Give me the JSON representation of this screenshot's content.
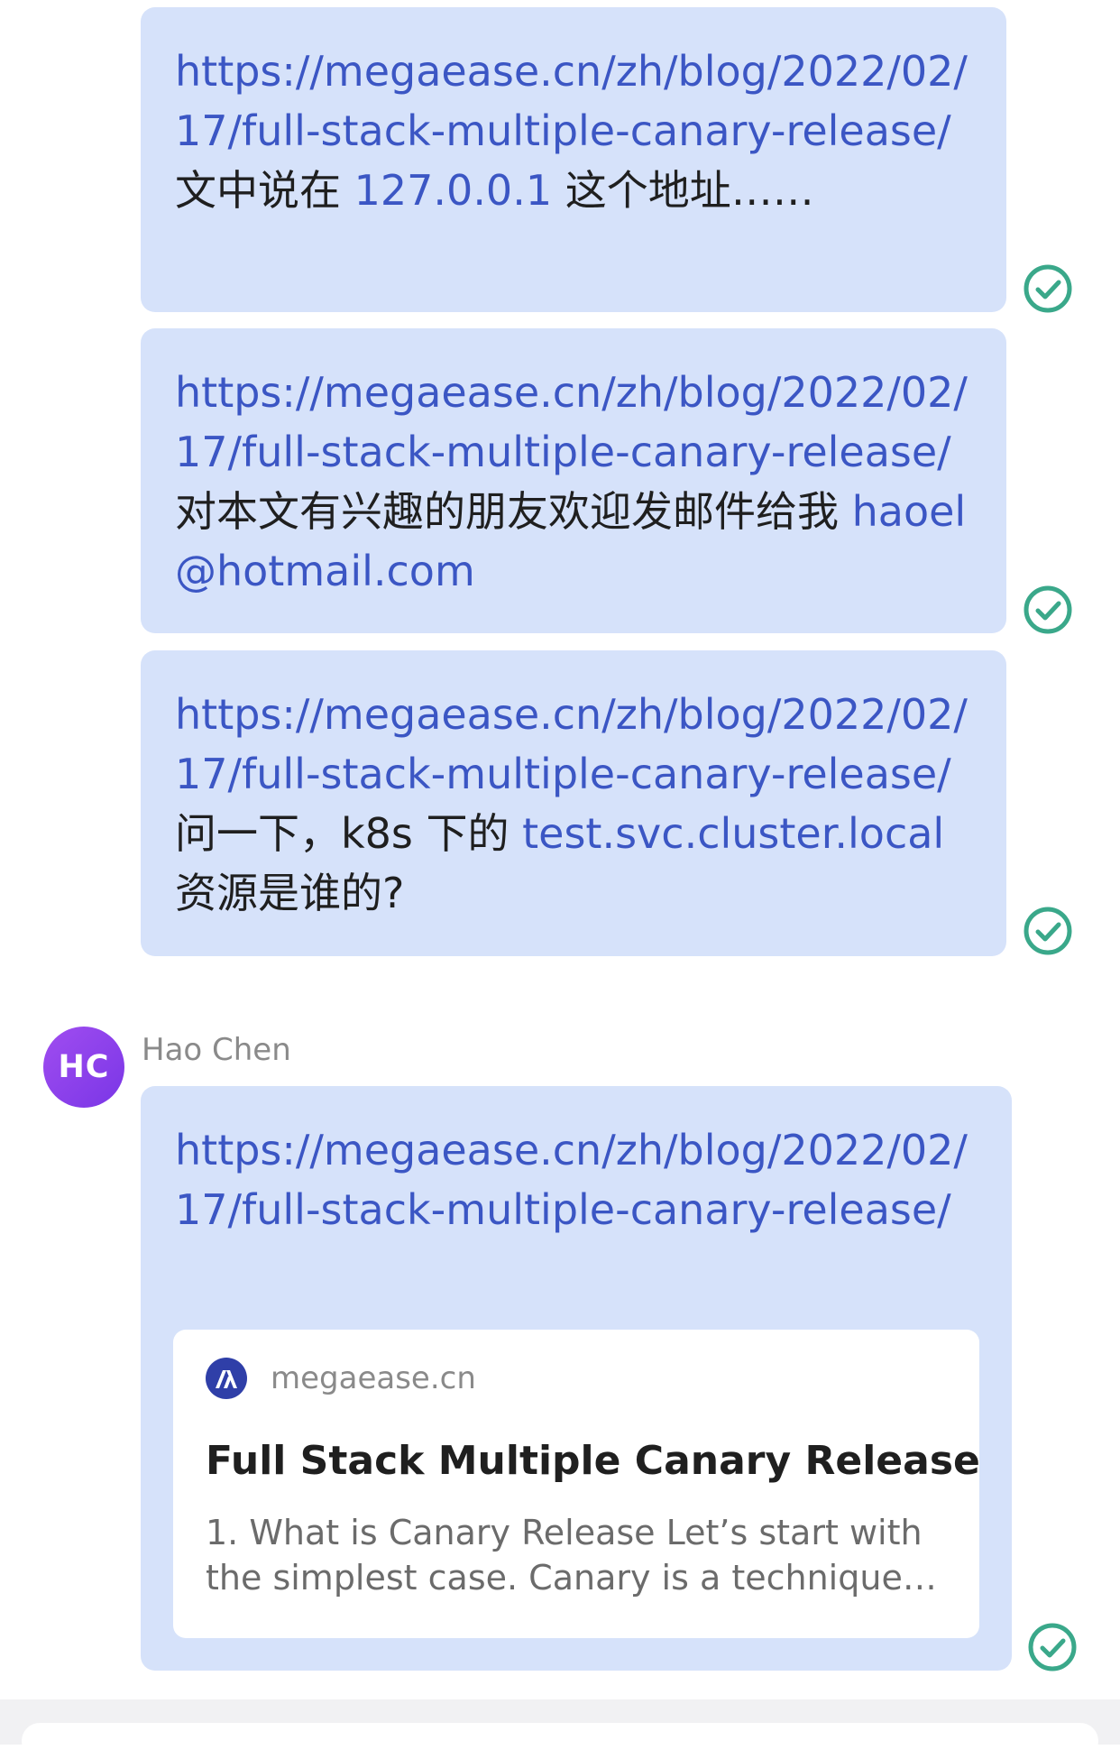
{
  "messages": [
    {
      "link": "https://megaease.cn/zh/blog/2022/02/17/full-stack-multiple-canary-release/",
      "text_a": " 文中说在 ",
      "ip": "127.0.0.1",
      "text_b": " 这个地址……"
    },
    {
      "link": "https://megaease.cn/zh/blog/2022/02/17/full-stack-multiple-canary-release/",
      "text_a": " 对本文有兴趣的朋友欢迎发邮件给我 ",
      "email": "haoel@hotmail.com"
    },
    {
      "link": "https://megaease.cn/zh/blog/2022/02/17/full-stack-multiple-canary-release/",
      "text_a": " 问一下，k8s 下的 ",
      "domain": "test.svc.cluster.local",
      "text_b": " 资源是谁的?"
    }
  ],
  "incoming": {
    "avatar_initials": "HC",
    "sender_name": "Hao Chen",
    "link": "https://megaease.cn/zh/blog/2022/02/17/full-stack-multiple-canary-release/",
    "preview": {
      "site": "megaease.cn",
      "title": "Full Stack Multiple Canary Release",
      "description": "1. What is Canary Release Let’s start with the simplest case. Canary is a technique…"
    }
  },
  "icons": {
    "read_receipt": "check-circle-icon",
    "site_logo": "megaease-logo-icon"
  },
  "colors": {
    "bubble": "#d6e2fa",
    "link": "#3b56c4",
    "check": "#3aa88a",
    "avatar": "#8b42ec"
  }
}
